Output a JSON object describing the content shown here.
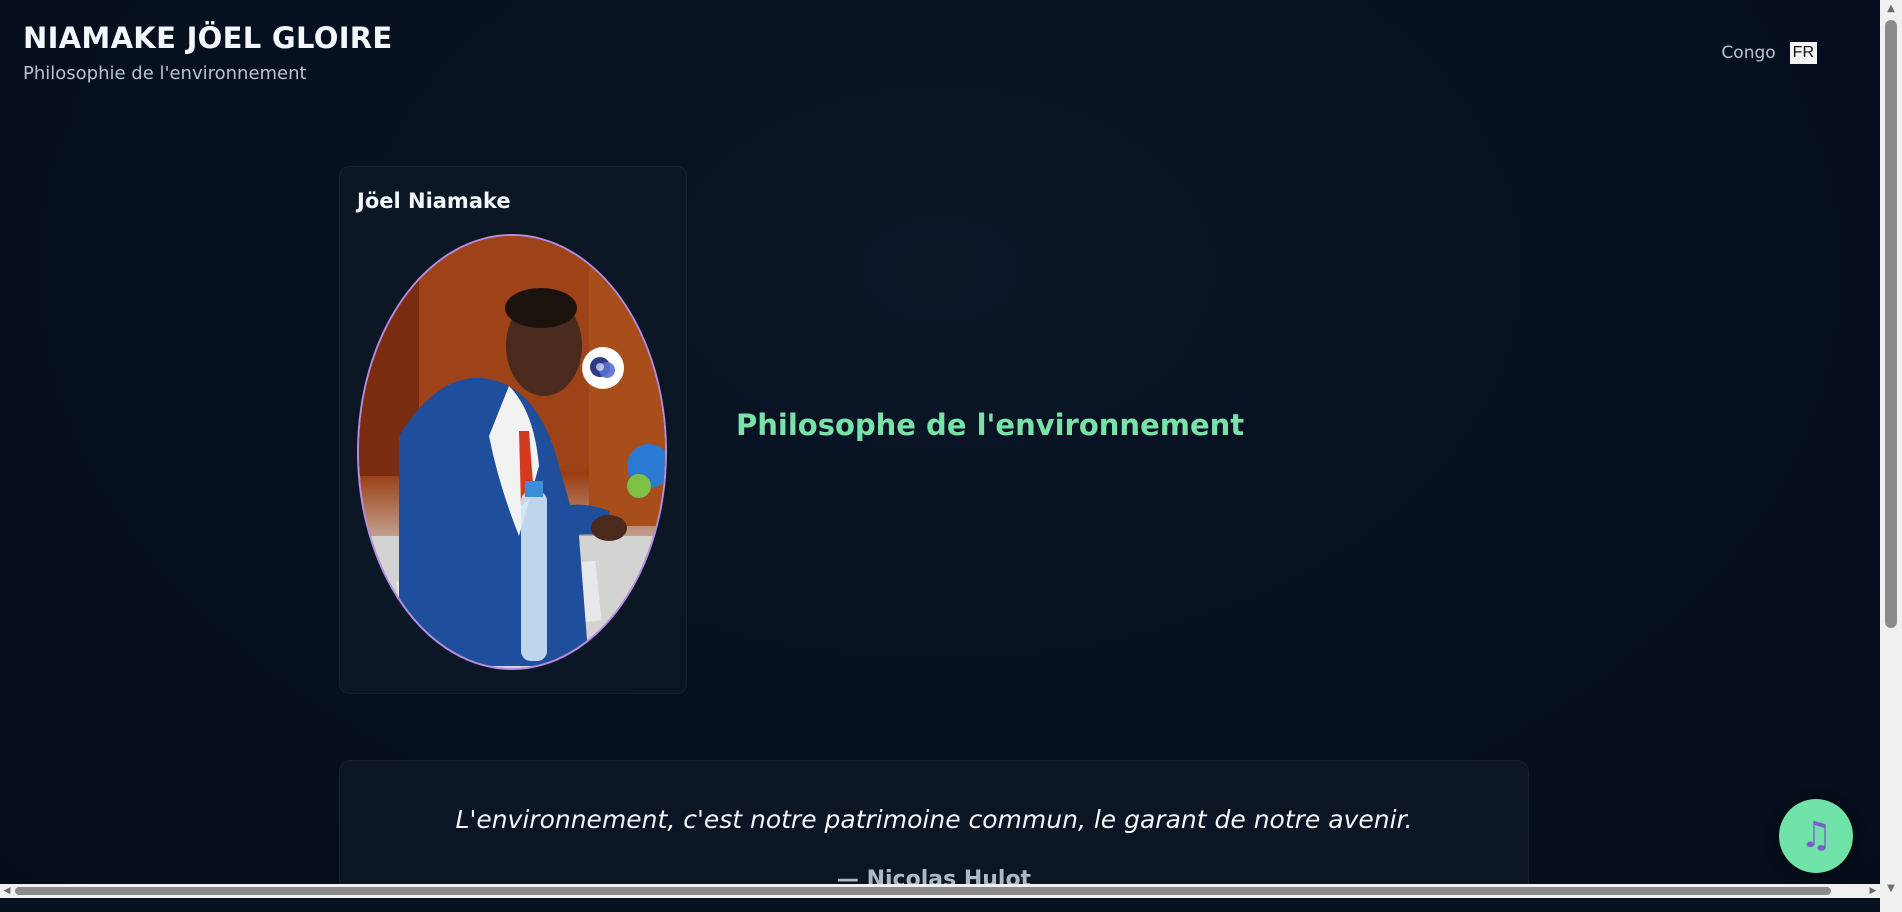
{
  "header": {
    "title": "NIAMAKE JÖEL GLOIRE",
    "subtitle": "Philosophie de l'environnement"
  },
  "language": {
    "country": "Congo",
    "code": "FR"
  },
  "profile": {
    "name": "Jöel Niamake",
    "role": "Philosophe de l'environnement",
    "photo_icon": "portrait-photo"
  },
  "quote": {
    "text": "L'environnement, c'est notre patrimoine commun, le garant de notre avenir.",
    "author": "— Nicolas Hulot"
  },
  "music_button": {
    "icon": "music-note-icon",
    "glyph": "♫"
  },
  "colors": {
    "background": "#07101f",
    "accent_green": "#78e2a8",
    "fab_green": "#6fe3a8",
    "portrait_border": "#b48be0"
  },
  "scrollbar": {
    "up": "▲",
    "down": "▼",
    "left": "◀",
    "right": "▶"
  }
}
